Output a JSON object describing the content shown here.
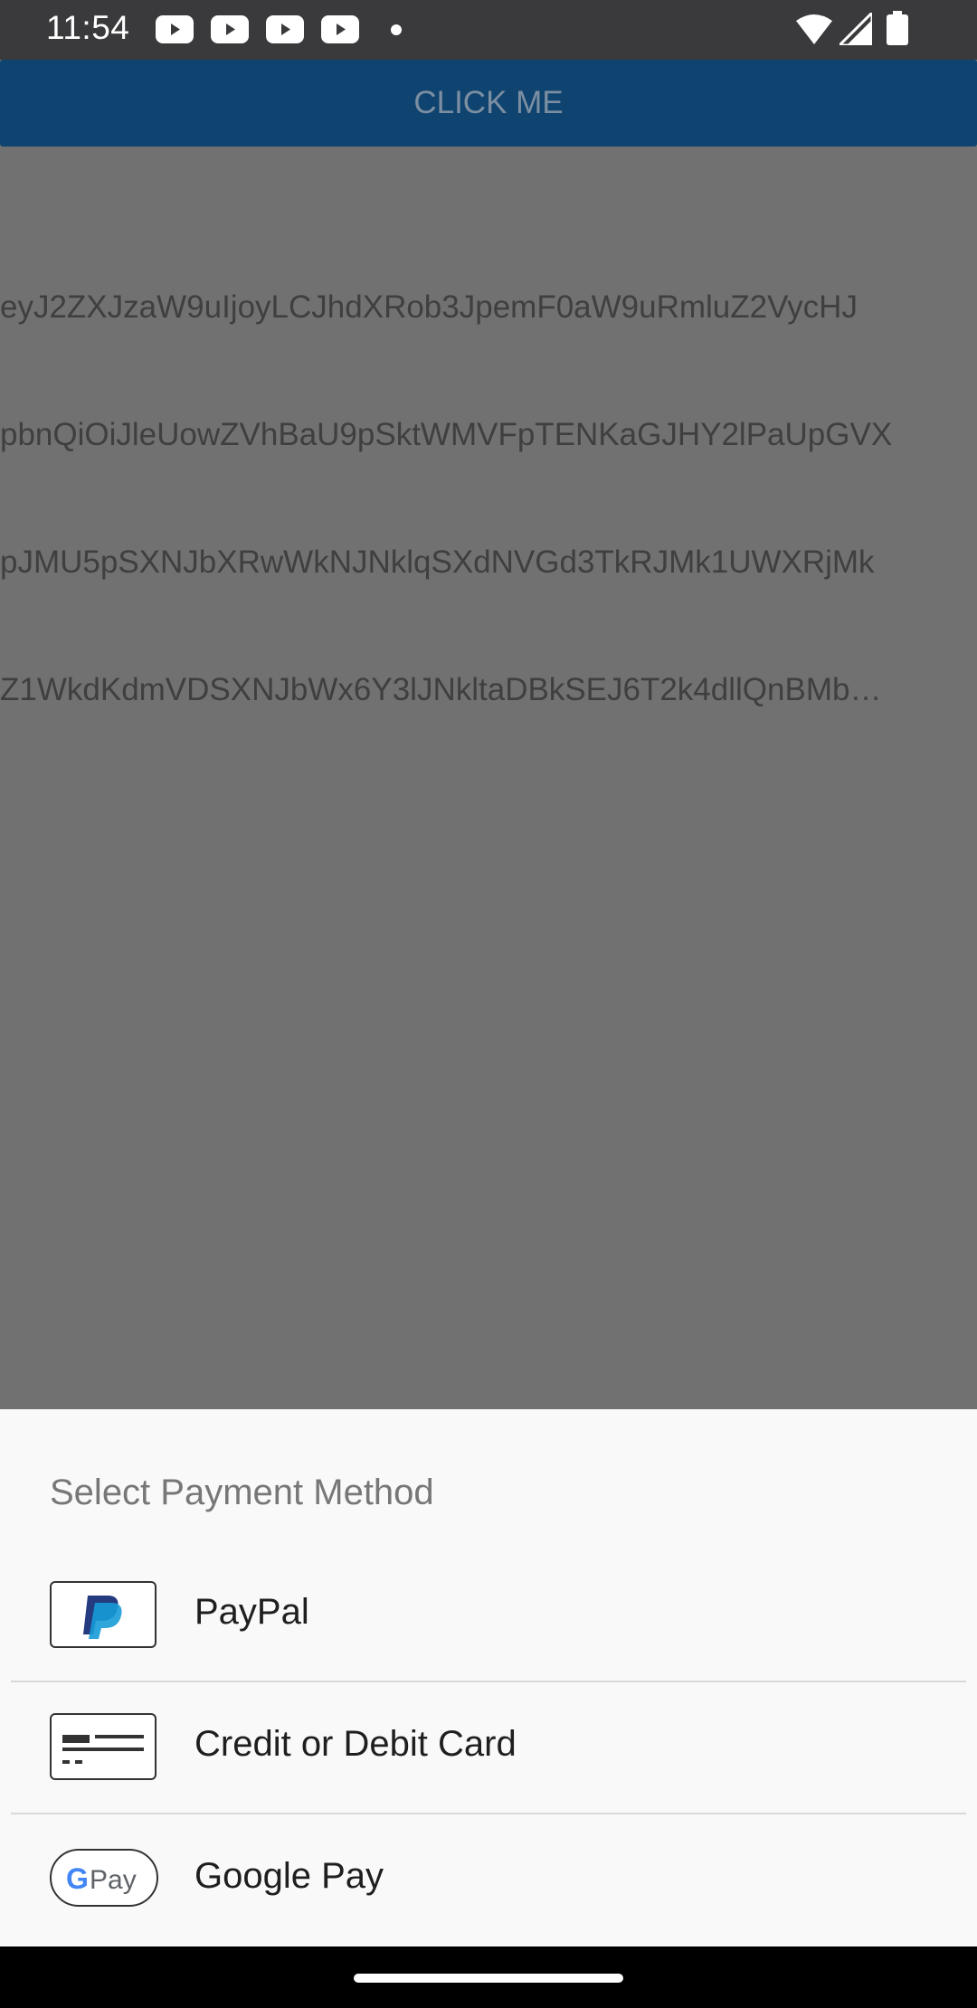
{
  "status_bar": {
    "time": "11:54",
    "icons": [
      "youtube-icon",
      "youtube-icon",
      "youtube-icon",
      "youtube-icon",
      "dot-icon",
      "wifi-icon",
      "signal-icon",
      "battery-icon"
    ]
  },
  "app": {
    "button_label": "CLICK ME",
    "token_lines": [
      "eyJ2ZXJzaW9uIjoyLCJhdXRob3JpemF0aW9uRmluZ2VycHJ",
      "pbnQiOiJleUowZVhBaU9pSktWMVFpTENKaGJHY2lPaUpGVX",
      "pJMU5pSXNJbXRwWkNJNklqSXdNVGd3TkRJMk1UWXRjMk",
      "Z1WkdKdmVDSXNJbWx6Y3lJNkltaDBkSEJ6T2k4dllQnBMb…"
    ]
  },
  "sheet": {
    "title": "Select Payment Method",
    "options": [
      {
        "label": "PayPal",
        "icon": "paypal-icon"
      },
      {
        "label": "Credit or Debit Card",
        "icon": "credit-card-icon"
      },
      {
        "label": "Google Pay",
        "icon": "google-pay-icon"
      }
    ]
  },
  "colors": {
    "scrim": "#717171",
    "button_bg": "#0f4470",
    "sheet_bg": "#f9f9f9",
    "paypal_dark": "#253b80",
    "paypal_light": "#179bd7"
  }
}
